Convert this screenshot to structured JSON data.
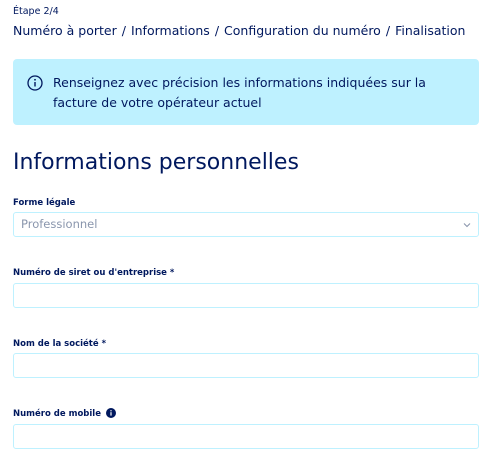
{
  "step": "Étape 2/4",
  "breadcrumb": {
    "items": [
      "Numéro à porter",
      "Informations",
      "Configuration du numéro",
      "Finalisation"
    ],
    "separator": "/"
  },
  "alert": {
    "message": "Renseignez avec précision les informations indiquées sur la facture de votre opérateur actuel",
    "icon": "info-circle-icon"
  },
  "section": {
    "title": "Informations personnelles"
  },
  "form": {
    "legal_form": {
      "label": "Forme légale",
      "value": "Professionnel"
    },
    "siret": {
      "label": "Numéro de siret ou d'entreprise *",
      "value": ""
    },
    "company_name": {
      "label": "Nom de la société *",
      "value": ""
    },
    "mobile": {
      "label": "Numéro de mobile",
      "value": ""
    }
  },
  "colors": {
    "text": "#00185e",
    "alert_background": "#bef1ff",
    "field_border": "#bef1ff",
    "placeholder": "#8a96ad"
  }
}
